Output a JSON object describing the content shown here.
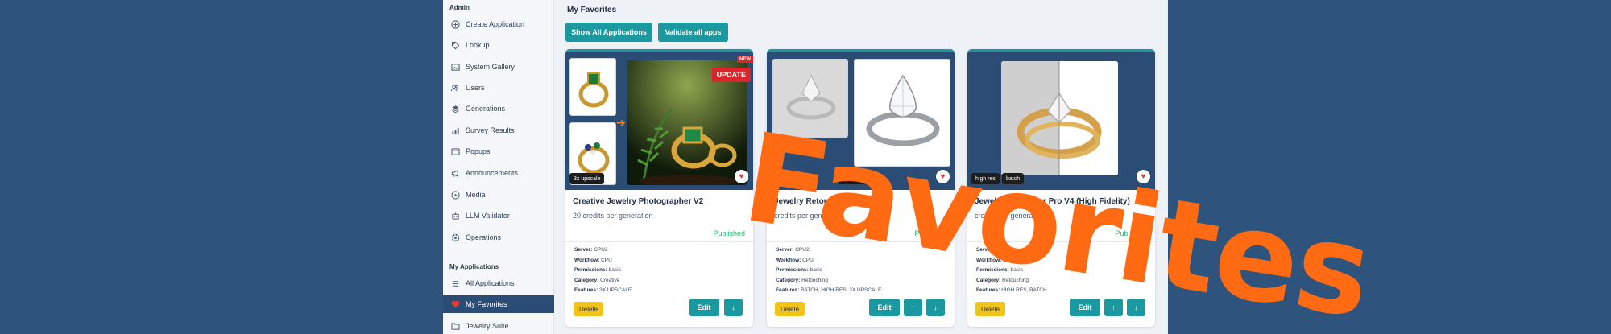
{
  "sidebar": {
    "admin_title": "Admin",
    "admin_items": [
      {
        "label": "Create Application",
        "icon": "plus-circle-icon"
      },
      {
        "label": "Lookup",
        "icon": "tag-icon"
      },
      {
        "label": "System Gallery",
        "icon": "image-icon"
      },
      {
        "label": "Users",
        "icon": "users-icon"
      },
      {
        "label": "Generations",
        "icon": "layers-icon"
      },
      {
        "label": "Survey Results",
        "icon": "bar-chart-icon"
      },
      {
        "label": "Popups",
        "icon": "window-icon"
      },
      {
        "label": "Announcements",
        "icon": "megaphone-icon"
      },
      {
        "label": "Media",
        "icon": "media-icon"
      },
      {
        "label": "LLM Validator",
        "icon": "robot-icon"
      },
      {
        "label": "Operations",
        "icon": "gear-icon"
      }
    ],
    "apps_title": "My Applications",
    "app_items": [
      {
        "label": "All Applications",
        "icon": "list-icon"
      },
      {
        "label": "My Favorites",
        "icon": "heart-icon",
        "active": true
      },
      {
        "label": "Jewelry Suite",
        "icon": "folder-icon"
      }
    ]
  },
  "main": {
    "title": "My Favorites",
    "show_all_label": "Show All Applications",
    "validate_label": "Validate all apps"
  },
  "cards": [
    {
      "title": "Creative Jewelry Photographer V2",
      "credits": "20 credits per generation",
      "status": "Published",
      "tags": [
        "3x upscale"
      ],
      "badge_new": "NEW",
      "badge_update": "UPDATE",
      "server_label": "Server:",
      "server": "CPU2",
      "workflow_label": "Workflow:",
      "workflow": "CPU",
      "permissions_label": "Permissions:",
      "permissions": "basic",
      "category_label": "Category:",
      "category": "Creative",
      "features_label": "Features:",
      "features": "3X UPSCALE",
      "delete_label": "Delete",
      "edit_label": "Edit",
      "down_icon": "↓"
    },
    {
      "title": "Jewelry Retoucher Pro",
      "credits": "credits per generation",
      "status": "Published",
      "tags": [
        "upscale"
      ],
      "server_label": "Server:",
      "server": "CPU2",
      "workflow_label": "Workflow:",
      "workflow": "CPU",
      "permissions_label": "Permissions:",
      "permissions": "basic",
      "category_label": "Category:",
      "category": "Retouching",
      "features_label": "Features:",
      "features": "BATCH, HIGH RES, 3X UPSCALE",
      "delete_label": "Delete",
      "edit_label": "Edit",
      "up_icon": "↑",
      "down_icon": "↓"
    },
    {
      "title": "Jewelry Retoucher Pro V4 (High Fidelity)",
      "credits": "credits per generation",
      "status": "Published",
      "tags": [
        "high res",
        "batch"
      ],
      "server_label": "Server:",
      "server": "CPU2",
      "workflow_label": "Workflow:",
      "workflow": "CPU",
      "permissions_label": "Permissions:",
      "permissions": "basic",
      "category_label": "Category:",
      "category": "Retouching",
      "features_label": "Features:",
      "features": "HIGH RES, BATCH",
      "delete_label": "Delete",
      "edit_label": "Edit",
      "up_icon": "↑",
      "down_icon": "↓"
    }
  ],
  "banner": {
    "text": "Favorites"
  },
  "colors": {
    "background": "#2e537c",
    "accent_teal": "#1a9aa0",
    "sidebar_active": "#2b4d75",
    "delete_yellow": "#f0c419",
    "published_green": "#2bb673",
    "banner_orange": "#ff6a13",
    "heart_red": "#e53935"
  }
}
